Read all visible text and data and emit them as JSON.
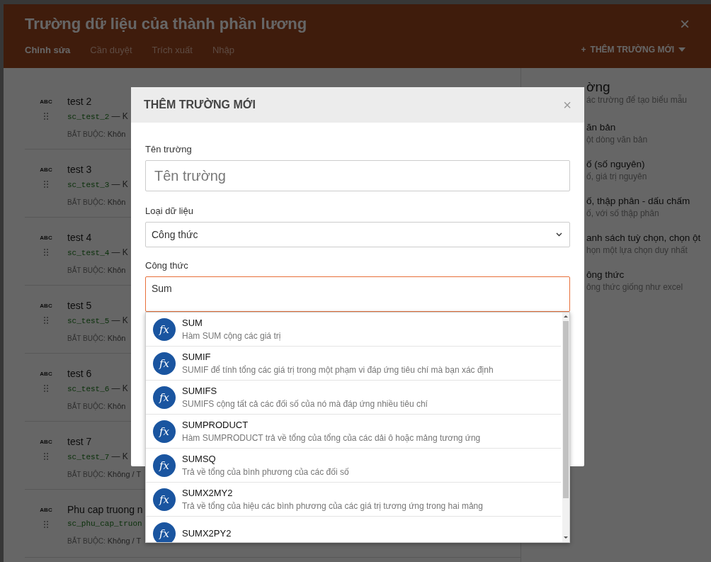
{
  "window": {
    "title": "Trường dữ liệu của thành phần lương",
    "close": "×"
  },
  "tabs": [
    {
      "label": "Chỉnh sửa",
      "selected": true
    },
    {
      "label": "Cần duyệt",
      "selected": false
    },
    {
      "label": "Trích xuất",
      "selected": false
    },
    {
      "label": "Nhập",
      "selected": false
    }
  ],
  "add_button": {
    "icon": "+",
    "label": "THÊM TRƯỜNG MỚI"
  },
  "fields": [
    {
      "type_badge": "ABC",
      "title": "test 2",
      "key": "sc_test_2",
      "key_suffix": "— K",
      "required_label": "BẮT BUỘC:",
      "required_value": "Khôn"
    },
    {
      "type_badge": "ABC",
      "title": "test 3",
      "key": "sc_test_3",
      "key_suffix": "— K",
      "required_label": "BẮT BUỘC:",
      "required_value": "Khôn"
    },
    {
      "type_badge": "ABC",
      "title": "test 4",
      "key": "sc_test_4",
      "key_suffix": "— K",
      "required_label": "BẮT BUỘC:",
      "required_value": "Khôn"
    },
    {
      "type_badge": "ABC",
      "title": "test 5",
      "key": "sc_test_5",
      "key_suffix": "— K",
      "required_label": "BẮT BUỘC:",
      "required_value": "Khôn"
    },
    {
      "type_badge": "ABC",
      "title": "test 6",
      "key": "sc_test_6",
      "key_suffix": "— K",
      "required_label": "BẮT BUỘC:",
      "required_value": "Khôn"
    },
    {
      "type_badge": "ABC",
      "title": "test 7",
      "key": "sc_test_7",
      "key_suffix": "— K",
      "required_label": "BẮT BUỘC:",
      "required_value": "Không / T"
    },
    {
      "type_badge": "ABC",
      "title": "Phu cap truong n",
      "key": "sc_phu_cap_truon",
      "required_label": "BẮT BUỘC:",
      "required_value": "Không / T"
    }
  ],
  "field_types": {
    "heading": "ờng",
    "subtitle": "ác trường để tạo biểu mẫu",
    "items": [
      {
        "title": "ăn bản",
        "description": "ột dòng văn bản"
      },
      {
        "title": "ố (số nguyên)",
        "description": "ố, giá trị nguyên"
      },
      {
        "title": "ố, thập phân - dấu chấm",
        "description": "ố, với số thập phân"
      },
      {
        "title": "anh sách tuỳ chọn, chọn ột",
        "description": "họn một lựa chọn duy nhất"
      },
      {
        "title": "ông thức",
        "description": "ông thức giống như excel"
      }
    ]
  },
  "dialog": {
    "title": "THÊM TRƯỜNG MỚI",
    "close": "×",
    "name_label": "Tên trường",
    "name_placeholder": "Tên trường",
    "type_label": "Loại dữ liệu",
    "type_value": "Công thức",
    "formula_label": "Công thức",
    "formula_value": "Sum",
    "suggestions": [
      {
        "icon": "fx",
        "name": "SUM",
        "description": "Hàm SUM cộng các giá trị"
      },
      {
        "icon": "fx",
        "name": "SUMIF",
        "description": "SUMIF để tính tổng các giá trị trong một phạm vi đáp ứng tiêu chí mà bạn xác định"
      },
      {
        "icon": "fx",
        "name": "SUMIFS",
        "description": "SUMIFS cộng tất cả các đối số của nó mà đáp ứng nhiều tiêu chí"
      },
      {
        "icon": "fx",
        "name": "SUMPRODUCT",
        "description": "Hàm SUMPRODUCT trả về tổng của tổng của các dải ô hoặc mảng tương ứng"
      },
      {
        "icon": "fx",
        "name": "SUMSQ",
        "description": "Trả về tổng của bình phương của các đối số"
      },
      {
        "icon": "fx",
        "name": "SUMX2MY2",
        "description": "Trả về tổng của hiệu các bình phương của các giá trị tương ứng trong hai mảng"
      },
      {
        "icon": "fx",
        "name": "SUMX2PY2"
      }
    ]
  }
}
